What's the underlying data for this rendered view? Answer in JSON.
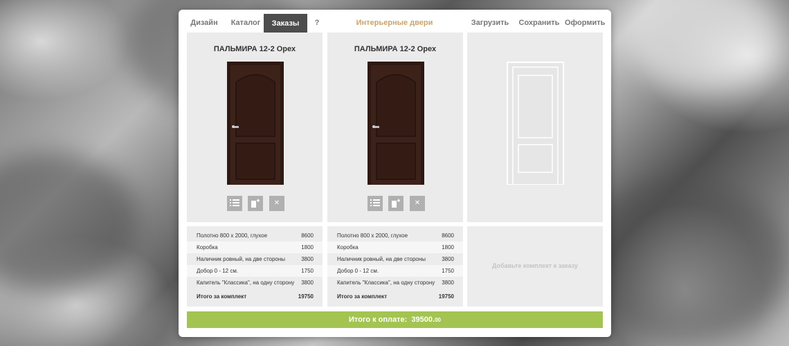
{
  "nav": {
    "design": "Дизайн",
    "catalog": "Каталог",
    "orders": "Заказы",
    "help": "?",
    "center": "Интерьерные двери",
    "load": "Загрузить",
    "save": "Сохранить",
    "checkout": "Оформить"
  },
  "doors": [
    {
      "title": "ПАЛЬМИРА 12-2 Орех",
      "items": [
        {
          "name": "Полотно 800 x 2000, глухое",
          "price": "8600"
        },
        {
          "name": "Коробка",
          "price": "1800"
        },
        {
          "name": "Наличник ровный, на две стороны",
          "price": "3800"
        },
        {
          "name": "Добор 0 - 12 см.",
          "price": "1750"
        },
        {
          "name": "Капитель \"Классика\", на одну сторону",
          "price": "3800"
        }
      ],
      "total_label": "Итого за комплект",
      "total": "19750"
    },
    {
      "title": "ПАЛЬМИРА 12-2 Орех",
      "items": [
        {
          "name": "Полотно 800 x 2000, глухое",
          "price": "8600"
        },
        {
          "name": "Коробка",
          "price": "1800"
        },
        {
          "name": "Наличник ровный, на две стороны",
          "price": "3800"
        },
        {
          "name": "Добор 0 - 12 см.",
          "price": "1750"
        },
        {
          "name": "Капитель \"Классика\", на одну сторону",
          "price": "3800"
        }
      ],
      "total_label": "Итого за комплект",
      "total": "19750"
    }
  ],
  "empty_slot": {
    "hint": "Добавьте комплект к заказу"
  },
  "payment": {
    "label": "Итого к оплате:",
    "amount": "39500.",
    "cents": "00"
  },
  "icons": {
    "list": "list-icon",
    "copy": "copy-add-icon",
    "remove": "close-icon"
  },
  "colors": {
    "accent": "#a3c451",
    "nav_center": "#c8a46e",
    "active_tab": "#4d4d4d",
    "door": "#3b2119"
  }
}
